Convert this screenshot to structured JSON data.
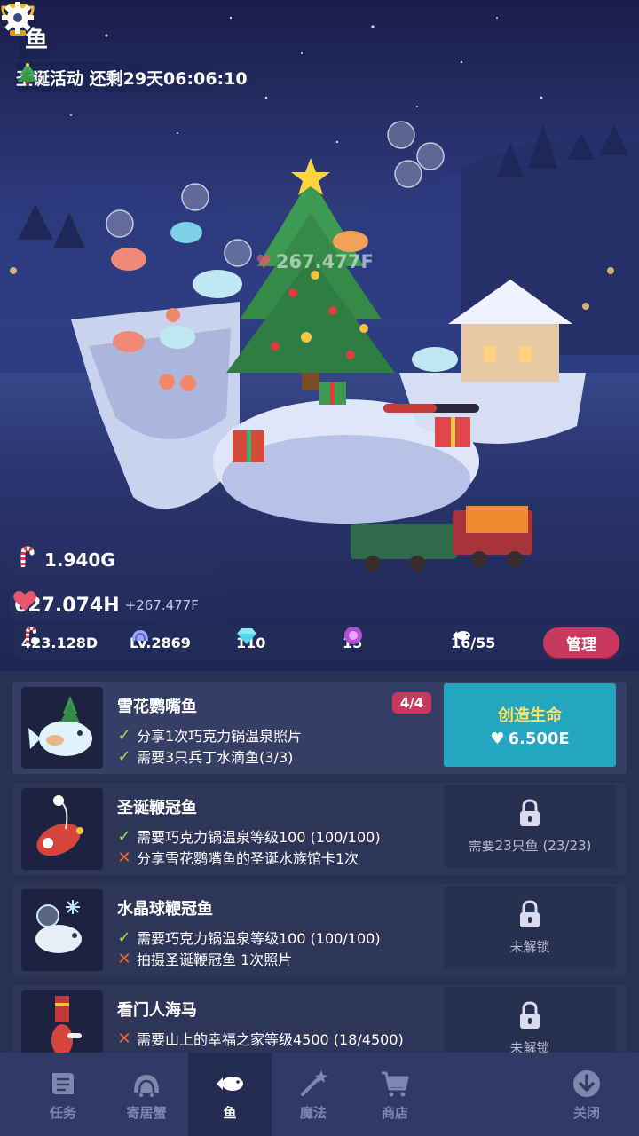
{
  "header": {
    "title": "鱼"
  },
  "event": {
    "label": "圣诞活动 还剩29天06:06:10"
  },
  "scene": {
    "floating_love": "267.477F"
  },
  "stats": {
    "gold": "1.940G",
    "love": "627.074H",
    "love_rate": "+267.477F",
    "candy": "423.128D",
    "level": "LV.2869",
    "gems": "110",
    "orbs": "15",
    "fish_count": "16/55",
    "manage_label": "管理"
  },
  "fish_list": [
    {
      "name": "雪花鹦嘴鱼",
      "badge": "4/4",
      "requirements": [
        {
          "status": "done",
          "text": "分享1次巧克力锅温泉照片"
        },
        {
          "status": "done",
          "text": "需要3只兵丁水滴鱼(3/3)"
        }
      ],
      "action": {
        "type": "create",
        "label": "创造生命",
        "cost": "6.500E"
      }
    },
    {
      "name": "圣诞鞭冠鱼",
      "requirements": [
        {
          "status": "done",
          "text": "需要巧克力锅温泉等级100 (100/100)"
        },
        {
          "status": "todo",
          "text": "分享雪花鹦嘴鱼的圣诞水族馆卡1次"
        }
      ],
      "action": {
        "type": "locked",
        "label": "需要23只鱼 (23/23)"
      }
    },
    {
      "name": "水晶球鞭冠鱼",
      "requirements": [
        {
          "status": "done",
          "text": "需要巧克力锅温泉等级100 (100/100)"
        },
        {
          "status": "todo",
          "text": "拍摄圣诞鞭冠鱼 1次照片"
        }
      ],
      "action": {
        "type": "locked",
        "label": "未解锁"
      }
    },
    {
      "name": "看门人海马",
      "requirements": [
        {
          "status": "todo",
          "text": "需要山上的幸福之家等级4500 (18/4500)"
        }
      ],
      "action": {
        "type": "locked",
        "label": "未解锁"
      }
    }
  ],
  "nav": [
    {
      "label": "任务",
      "icon": "quest-icon"
    },
    {
      "label": "寄居蟹",
      "icon": "hermit-crab-icon"
    },
    {
      "label": "鱼",
      "icon": "fish-icon",
      "active": true
    },
    {
      "label": "魔法",
      "icon": "magic-wand-icon"
    },
    {
      "label": "商店",
      "icon": "cart-icon"
    },
    {
      "label": "关闭",
      "icon": "collapse-icon"
    }
  ],
  "colors": {
    "accent": "#c7395f",
    "create": "#25a6c0",
    "done": "#9fe04a",
    "todo": "#f06a2c"
  }
}
